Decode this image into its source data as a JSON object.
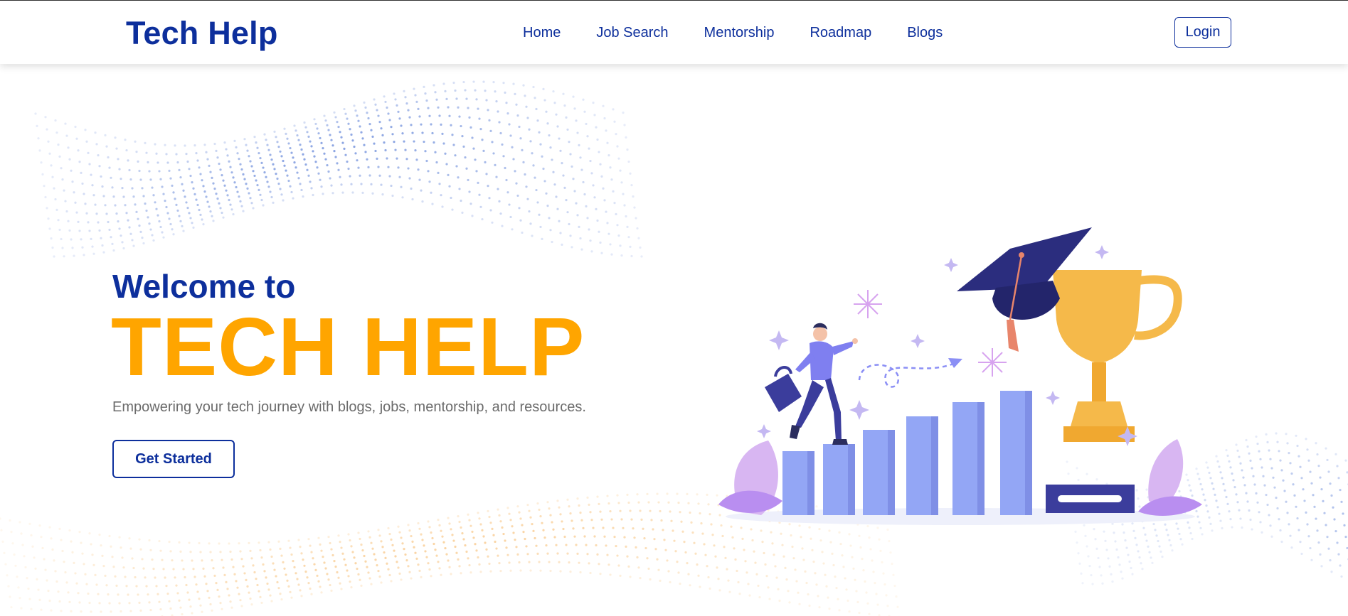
{
  "header": {
    "logo": "Tech Help",
    "nav": [
      {
        "label": "Home"
      },
      {
        "label": "Job Search"
      },
      {
        "label": "Mentorship"
      },
      {
        "label": "Roadmap"
      },
      {
        "label": "Blogs"
      }
    ],
    "login_label": "Login"
  },
  "hero": {
    "welcome": "Welcome to",
    "brand": "TECH HELP",
    "tagline": "Empowering your tech journey with blogs, jobs, mentorship, and resources.",
    "cta_label": "Get Started"
  },
  "colors": {
    "primary": "#0d2f9c",
    "accent": "#ffa500",
    "bar": "#93a6f5",
    "trophy": "#f5b94a"
  },
  "illustration": {
    "icons": [
      "graduation-cap-icon",
      "trophy-icon",
      "briefcase-icon",
      "person-icon",
      "growth-bars-icon"
    ]
  }
}
